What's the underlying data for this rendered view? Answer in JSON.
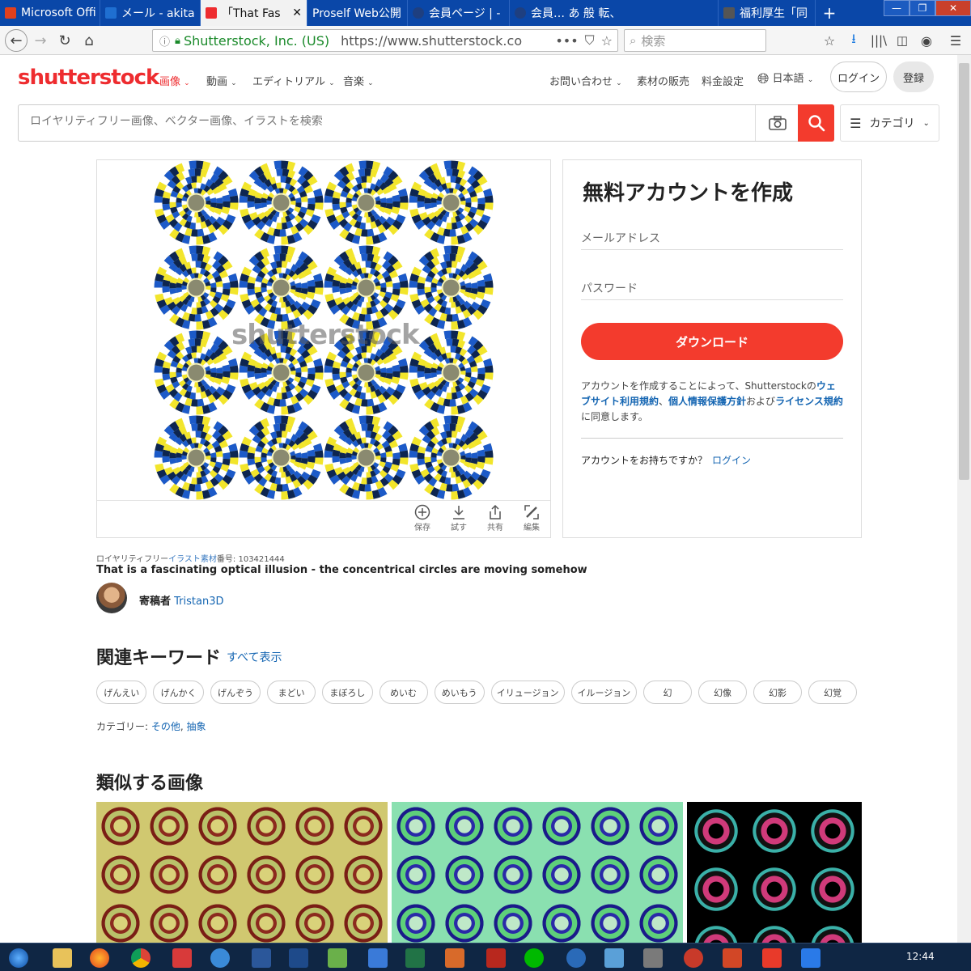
{
  "browser": {
    "tabs": [
      {
        "title": "Microsoft Offi",
        "color": "#e0401e"
      },
      {
        "title": "メール - akita",
        "color": "#1f6fd1"
      },
      {
        "title": "「That Fas",
        "color": "#ee2c2f",
        "active": true
      },
      {
        "title": "Proself Web公開",
        "color": "#2565c5"
      },
      {
        "title": "会員ページ | -",
        "color": "#1e3f80"
      },
      {
        "title": "会員… あ 般 転、 ",
        "color": "#1e3f80"
      },
      {
        "title": "福利厚生「同",
        "color": "#555555"
      }
    ],
    "new_tab": "+",
    "window_controls": {
      "minimize": "—",
      "maximize": "❐",
      "close": "✕"
    },
    "site_identity": "Shutterstock, Inc. (US)",
    "url": "https://www.shutterstock.co",
    "search_placeholder": "検索"
  },
  "site": {
    "logo": "shutterstock",
    "nav": [
      {
        "label": "画像",
        "accent": true
      },
      {
        "label": "動画"
      },
      {
        "label": "エディトリアル"
      },
      {
        "label": "音楽"
      }
    ],
    "right_nav": {
      "contact": "お問い合わせ",
      "sell": "素材の販売",
      "pricing": "料金設定",
      "language": "日本語"
    },
    "login": "ログイン",
    "register": "登録",
    "search_placeholder": "ロイヤリティフリー画像、ベクター画像、イラストを検索",
    "category_button": "カテゴリ",
    "accent_color": "#f33b2d"
  },
  "preview": {
    "watermark": "shutterstock",
    "actions": [
      {
        "label": "保存",
        "icon": "plus-circle-icon"
      },
      {
        "label": "試す",
        "icon": "download-icon"
      },
      {
        "label": "共有",
        "icon": "share-icon"
      },
      {
        "label": "編集",
        "icon": "edit-icon"
      }
    ],
    "colors": {
      "yellow": "#f2e52b",
      "blue": "#1c5ac8",
      "navy": "#0d2550",
      "pale": "#f7f3b8",
      "white": "#ffffff",
      "grey": "#8a8a70"
    }
  },
  "signup": {
    "title": "無料アカウントを作成",
    "email_label": "メールアドレス",
    "password_label": "パスワード",
    "download_button": "ダウンロード",
    "terms_prefix": "アカウントを作成することによって、Shutterstockの",
    "terms_link1": "ウェブサイト利用規約",
    "terms_sep1": "、",
    "terms_link2": "個人情報保護方針",
    "terms_mid": "および",
    "terms_link3": "ライセンス規約",
    "terms_suffix": "に同意します。",
    "have_account": "アカウントをお持ちですか？",
    "login_link": "ログイン"
  },
  "image_info": {
    "meta_prefix": "ロイヤリティフリー",
    "meta_link": "イラスト素材",
    "meta_suffix": "番号: 103421444",
    "title": "That is a fascinating optical illusion - the concentrical circles are moving somehow",
    "contributor_label": "寄稿者",
    "contributor_name": "Tristan3D"
  },
  "keywords": {
    "heading": "関連キーワード",
    "show_all": "すべて表示",
    "items": [
      "げんえい",
      "げんかく",
      "げんぞう",
      "まどい",
      "まぼろし",
      "めいむ",
      "めいもう",
      "イリュージョン",
      "イルージョン",
      "幻",
      "幻像",
      "幻影",
      "幻覚"
    ]
  },
  "categories": {
    "label": "カテゴリー:",
    "items": [
      "その他",
      "抽象"
    ],
    "sep": ", "
  },
  "similar": {
    "heading": "類似する画像"
  },
  "taskbar": {
    "time": "12:44"
  }
}
